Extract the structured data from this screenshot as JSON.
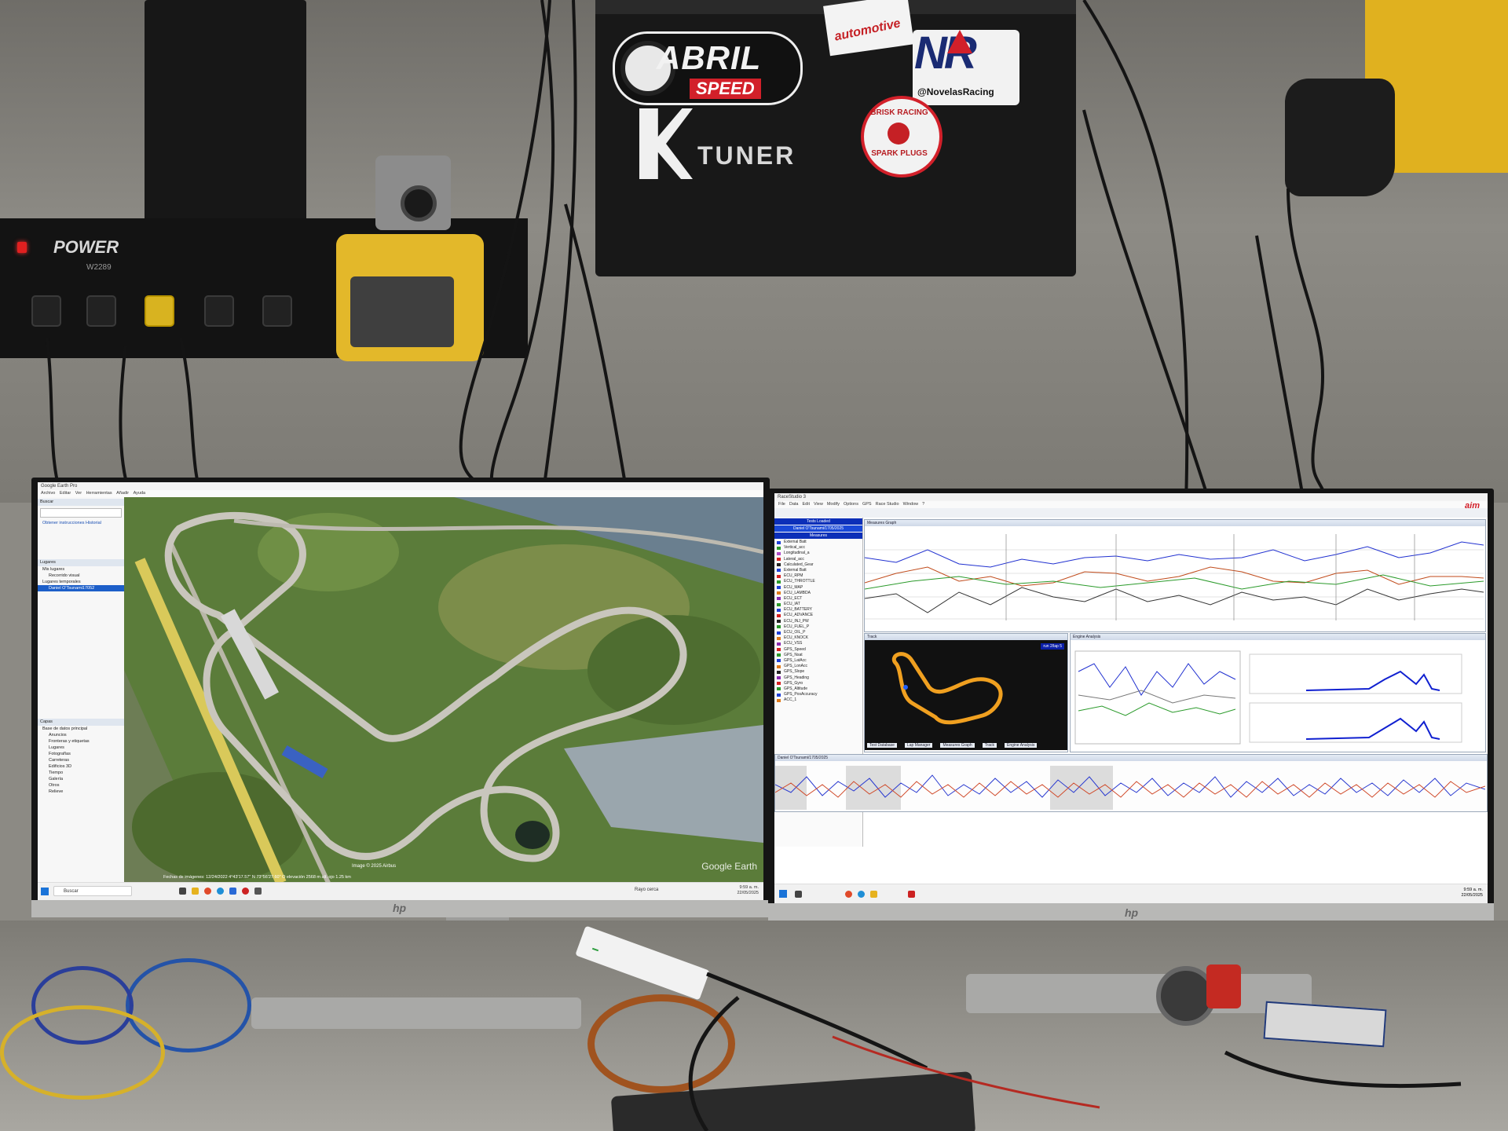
{
  "wall_labels": {
    "power_brand": "POWER",
    "power_model": "W2289",
    "abril_name": "ABRIL",
    "abril_speed": "SPEED",
    "automotive": "automotive",
    "nr_logo": "NR",
    "nr_handle": "@NovelasRacing",
    "k_tuner": "TUNER",
    "brisk_top": "BRISK RACING",
    "brisk_bottom": "SPARK PLUGS"
  },
  "left_monitor": {
    "brand": "hp",
    "window_title": "Google Earth Pro",
    "menu": [
      "Archivo",
      "Editar",
      "Ver",
      "Herramientas",
      "Añadir",
      "Ayuda"
    ],
    "sidebar": {
      "search_header": "Buscar",
      "search_links": "Obtener instrucciones   Historial",
      "places_header": "Lugares",
      "places": [
        {
          "label": "Mis lugares",
          "selected": false,
          "sub": false
        },
        {
          "label": "Recorrido visual",
          "selected": false,
          "sub": true
        },
        {
          "label": "Lugares temporales",
          "selected": false,
          "sub": false
        },
        {
          "label": "Daniel O'Tsunami17052",
          "selected": true,
          "sub": true
        }
      ],
      "layers_header": "Capas",
      "layers": [
        "Base de datos principal",
        "Anuncios",
        "Fronteras y etiquetas",
        "Lugares",
        "Fotografías",
        "Carreteras",
        "Edificios 3D",
        "Tiempo",
        "Galería",
        "Otros",
        "Relieve"
      ]
    },
    "map": {
      "copyright": "Image © 2025 Airbus",
      "status": "Fechas de imágenes: 12/24/2022   4°43'17.57\" N   73°56'27.60\" O   elevación 2568 m   alt. ojo 1.25 km",
      "logo": "Google Earth"
    },
    "taskbar": {
      "search_placeholder": "Buscar",
      "weather": "Rayo cerca",
      "time": "9:59 a. m.",
      "date": "22/05/2025"
    }
  },
  "right_monitor": {
    "brand": "hp",
    "window_title": "RaceStudio 3",
    "menu": [
      "File",
      "Data",
      "Edit",
      "View",
      "Modify",
      "Options",
      "GPS",
      "Race Studio",
      "Window",
      "?"
    ],
    "logo": "aim",
    "sidebar": {
      "tests_loaded_header": "Tests Loaded",
      "test_name": "Daniel O'Tsunami/1705/2025",
      "measures_header": "Measures",
      "channels": [
        {
          "name": "External Batt",
          "color": "#1f3fd6"
        },
        {
          "name": "Vertical_acc",
          "color": "#2a9a2a"
        },
        {
          "name": "Longitudinal_a",
          "color": "#b04ac8"
        },
        {
          "name": "Lateral_acc",
          "color": "#d62020"
        },
        {
          "name": "Calculated_Gear",
          "color": "#222222"
        },
        {
          "name": "External Batt",
          "color": "#1f3fd6"
        },
        {
          "name": "ECU_RPM",
          "color": "#d62020"
        },
        {
          "name": "ECU_THROTTLE",
          "color": "#2a9a2a"
        },
        {
          "name": "ECU_MAP",
          "color": "#1f3fd6"
        },
        {
          "name": "ECU_LAMBDA",
          "color": "#e07a1a"
        },
        {
          "name": "ECU_ECT",
          "color": "#8a2ab0"
        },
        {
          "name": "ECU_IAT",
          "color": "#2a9a2a"
        },
        {
          "name": "ECU_BATTERY",
          "color": "#1f3fd6"
        },
        {
          "name": "ECU_ADVANCE",
          "color": "#d62020"
        },
        {
          "name": "ECU_INJ_PW",
          "color": "#222222"
        },
        {
          "name": "ECU_FUEL_P",
          "color": "#2a9a2a"
        },
        {
          "name": "ECU_OIL_P",
          "color": "#1f3fd6"
        },
        {
          "name": "ECU_KNOCK",
          "color": "#e07a1a"
        },
        {
          "name": "ECU_VSS",
          "color": "#8a2ab0"
        },
        {
          "name": "GPS_Speed",
          "color": "#d62020"
        },
        {
          "name": "GPS_Nsat",
          "color": "#2a9a2a"
        },
        {
          "name": "GPS_LatAcc",
          "color": "#1f3fd6"
        },
        {
          "name": "GPS_LonAcc",
          "color": "#e07a1a"
        },
        {
          "name": "GPS_Slope",
          "color": "#222222"
        },
        {
          "name": "GPS_Heading",
          "color": "#8a2ab0"
        },
        {
          "name": "GPS_Gyro",
          "color": "#d62020"
        },
        {
          "name": "GPS_Altitude",
          "color": "#2a9a2a"
        },
        {
          "name": "GPS_PosAccuracy",
          "color": "#1f3fd6"
        },
        {
          "name": "ACC_1",
          "color": "#e07a1a"
        }
      ]
    },
    "panels": {
      "measures_graph": "Measures Graph",
      "track_map": "Track",
      "track_map_label": "run 2/lap 5",
      "engine_analysis": "Engine Analysis",
      "split_report": "Daniel O'Tsunami/1705/2025",
      "bottom_tabs": [
        "Test Database",
        "Lap Manager",
        "Measures Graph",
        "Track",
        "Engine Analysis"
      ]
    },
    "taskbar": {
      "time": "9:59 a. m.",
      "date": "22/05/2025"
    }
  }
}
